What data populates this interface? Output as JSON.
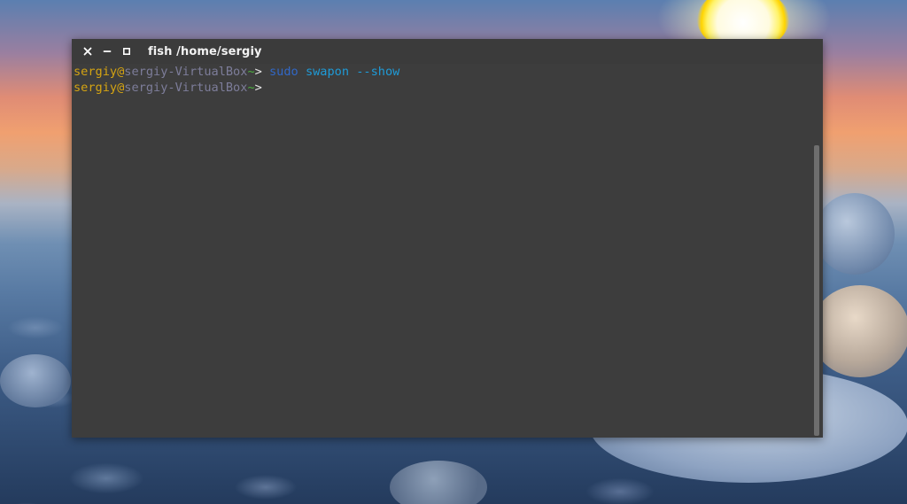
{
  "window": {
    "title": "fish  /home/sergiy",
    "buttons": {
      "close_icon": "close-icon",
      "minimize_icon": "minimize-icon",
      "maximize_icon": "maximize-icon"
    }
  },
  "terminal": {
    "lines": [
      {
        "user": "sergiy",
        "at": "@",
        "host": "sergiy-VirtualBox",
        "path": "~",
        "prompt": "> ",
        "command": "sudo",
        "arg": "swapon",
        "option": "--show"
      },
      {
        "user": "sergiy",
        "at": "@",
        "host": "sergiy-VirtualBox",
        "path": "~",
        "prompt": ">",
        "command": "",
        "arg": "",
        "option": ""
      }
    ]
  },
  "colors": {
    "terminal_bg": "#3d3d3d",
    "user": "#d5a412",
    "host": "#7d7d9a",
    "path": "#4bb03e",
    "command": "#3168c8",
    "argument": "#1e9bd8"
  },
  "scroll": {
    "thumb_start_fraction": 0.22,
    "thumb_end_fraction": 1.0
  }
}
